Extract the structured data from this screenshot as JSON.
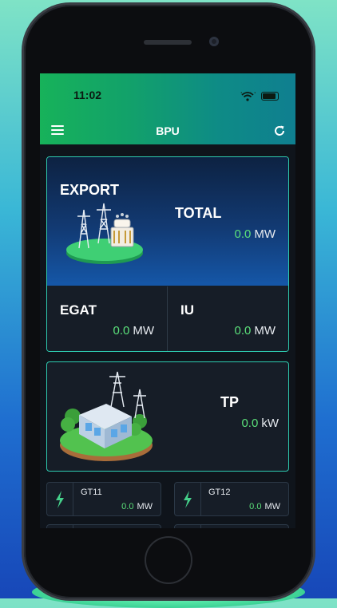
{
  "status": {
    "time": "11:02"
  },
  "app": {
    "title": "BPU"
  },
  "export_card": {
    "title": "EXPORT",
    "total": {
      "label": "TOTAL",
      "value": "0.0",
      "unit": "MW"
    },
    "egat": {
      "label": "EGAT",
      "value": "0.0",
      "unit": "MW"
    },
    "iu": {
      "label": "IU",
      "value": "0.0",
      "unit": "MW"
    }
  },
  "tp_card": {
    "label": "TP",
    "value": "0.0",
    "unit": "kW"
  },
  "generators": [
    {
      "name": "GT11",
      "value": "0.0",
      "unit": "MW"
    },
    {
      "name": "GT12",
      "value": "0.0",
      "unit": "MW"
    }
  ],
  "colors": {
    "value_green": "#5be07a",
    "card_border": "#2ecbb0",
    "bolt": "#45d08a"
  }
}
